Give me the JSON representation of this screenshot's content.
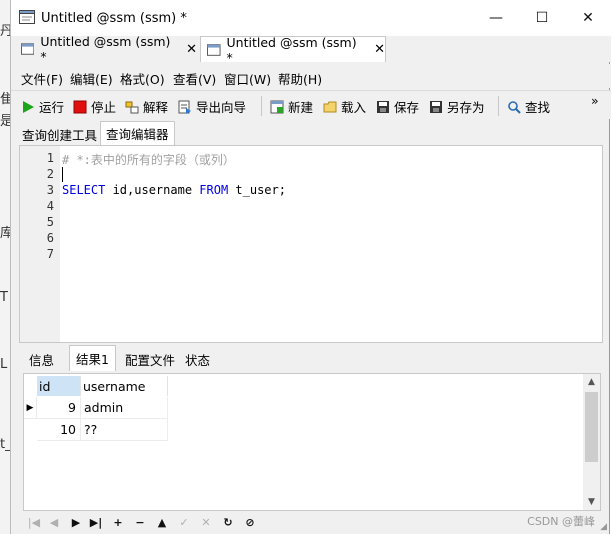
{
  "window": {
    "title": "Untitled @ssm (ssm) *",
    "minimize": "—",
    "maximize": "☐",
    "close": "✕"
  },
  "doc_tabs": [
    {
      "label": "Untitled @ssm (ssm) *",
      "close": "✕"
    },
    {
      "label": "Untitled @ssm (ssm) *",
      "close": "✕"
    }
  ],
  "menu": [
    "文件(F)",
    "编辑(E)",
    "格式(O)",
    "查看(V)",
    "窗口(W)",
    "帮助(H)"
  ],
  "toolbar": {
    "run": "运行",
    "stop": "停止",
    "explain": "解释",
    "export_wizard": "导出向导",
    "new": "新建",
    "load": "载入",
    "save": "保存",
    "save_as": "另存为",
    "find": "查找",
    "overflow": "»"
  },
  "sub_tabs": [
    "查询创建工具",
    "查询编辑器"
  ],
  "editor": {
    "line_numbers": [
      "1",
      "2",
      "3",
      "4",
      "5",
      "6",
      "7"
    ],
    "line1_comment": "# *:表中的所有的字段（或列）",
    "line3": {
      "kw1": "SELECT",
      "mid": " id,username ",
      "kw2": "FROM",
      "rest": " t_user;"
    }
  },
  "result_tabs": [
    "信息",
    "结果1",
    "配置文件",
    "状态"
  ],
  "grid": {
    "columns": [
      "id",
      "username"
    ],
    "rows": [
      {
        "id": "9",
        "username": "admin"
      },
      {
        "id": "10",
        "username": "??"
      }
    ],
    "current_row_marker": "▶"
  },
  "nav_buttons": [
    "|◀",
    "◀",
    "▶",
    "▶|",
    "+",
    "−",
    "▲",
    "✓",
    "✕",
    "↻",
    "⊘"
  ],
  "left_strip_chars": [
    "丹",
    "隹",
    "是",
    "库",
    "T",
    "L",
    "t_"
  ],
  "watermark": "CSDN @蕾峰",
  "colors": {
    "keyword": "#0000e6",
    "comment": "#a0a0a0",
    "run_green": "#1aa51a",
    "stop_red": "#e01010"
  }
}
